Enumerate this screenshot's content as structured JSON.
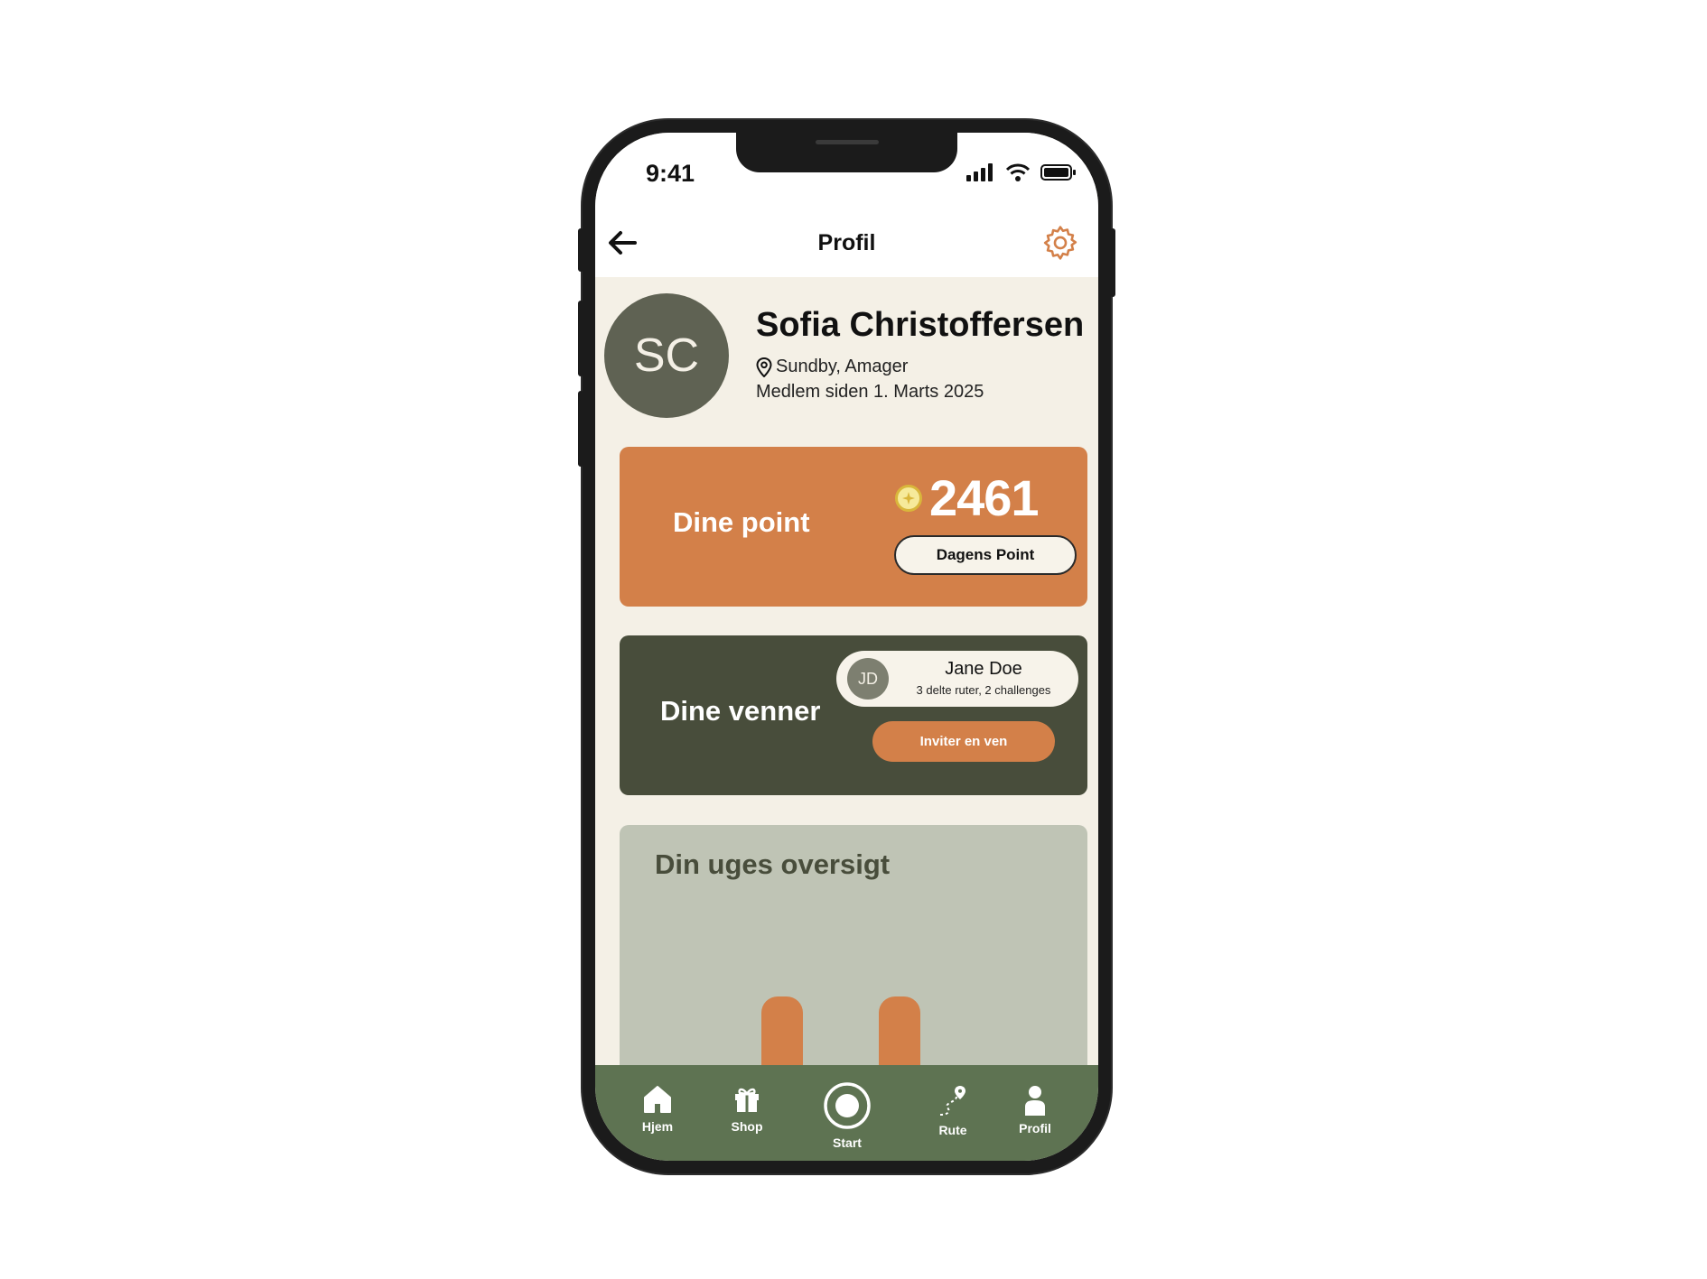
{
  "status_bar": {
    "time": "9:41"
  },
  "header": {
    "title": "Profil"
  },
  "profile": {
    "initials": "SC",
    "name": "Sofia Christoffersen",
    "location": "Sundby, Amager",
    "member_since": "Medlem siden 1. Marts 2025"
  },
  "points": {
    "label": "Dine point",
    "value": "2461",
    "daily_button": "Dagens Point"
  },
  "friends": {
    "label": "Dine venner",
    "friend": {
      "initials": "JD",
      "name": "Jane Doe",
      "meta": "3 delte ruter, 2 challenges"
    },
    "invite_button": "Inviter en ven"
  },
  "week": {
    "title": "Din uges oversigt"
  },
  "tabbar": {
    "items": [
      {
        "label": "Hjem",
        "icon": "home-icon"
      },
      {
        "label": "Shop",
        "icon": "gift-icon"
      },
      {
        "label": "Start",
        "icon": "record-icon"
      },
      {
        "label": "Rute",
        "icon": "route-icon"
      },
      {
        "label": "Profil",
        "icon": "person-icon"
      }
    ]
  },
  "colors": {
    "orange": "#d38049",
    "dark_green": "#484d3b",
    "tab_green": "#5e7352",
    "sage": "#bfc4b5",
    "cream": "#f4f0e6"
  }
}
